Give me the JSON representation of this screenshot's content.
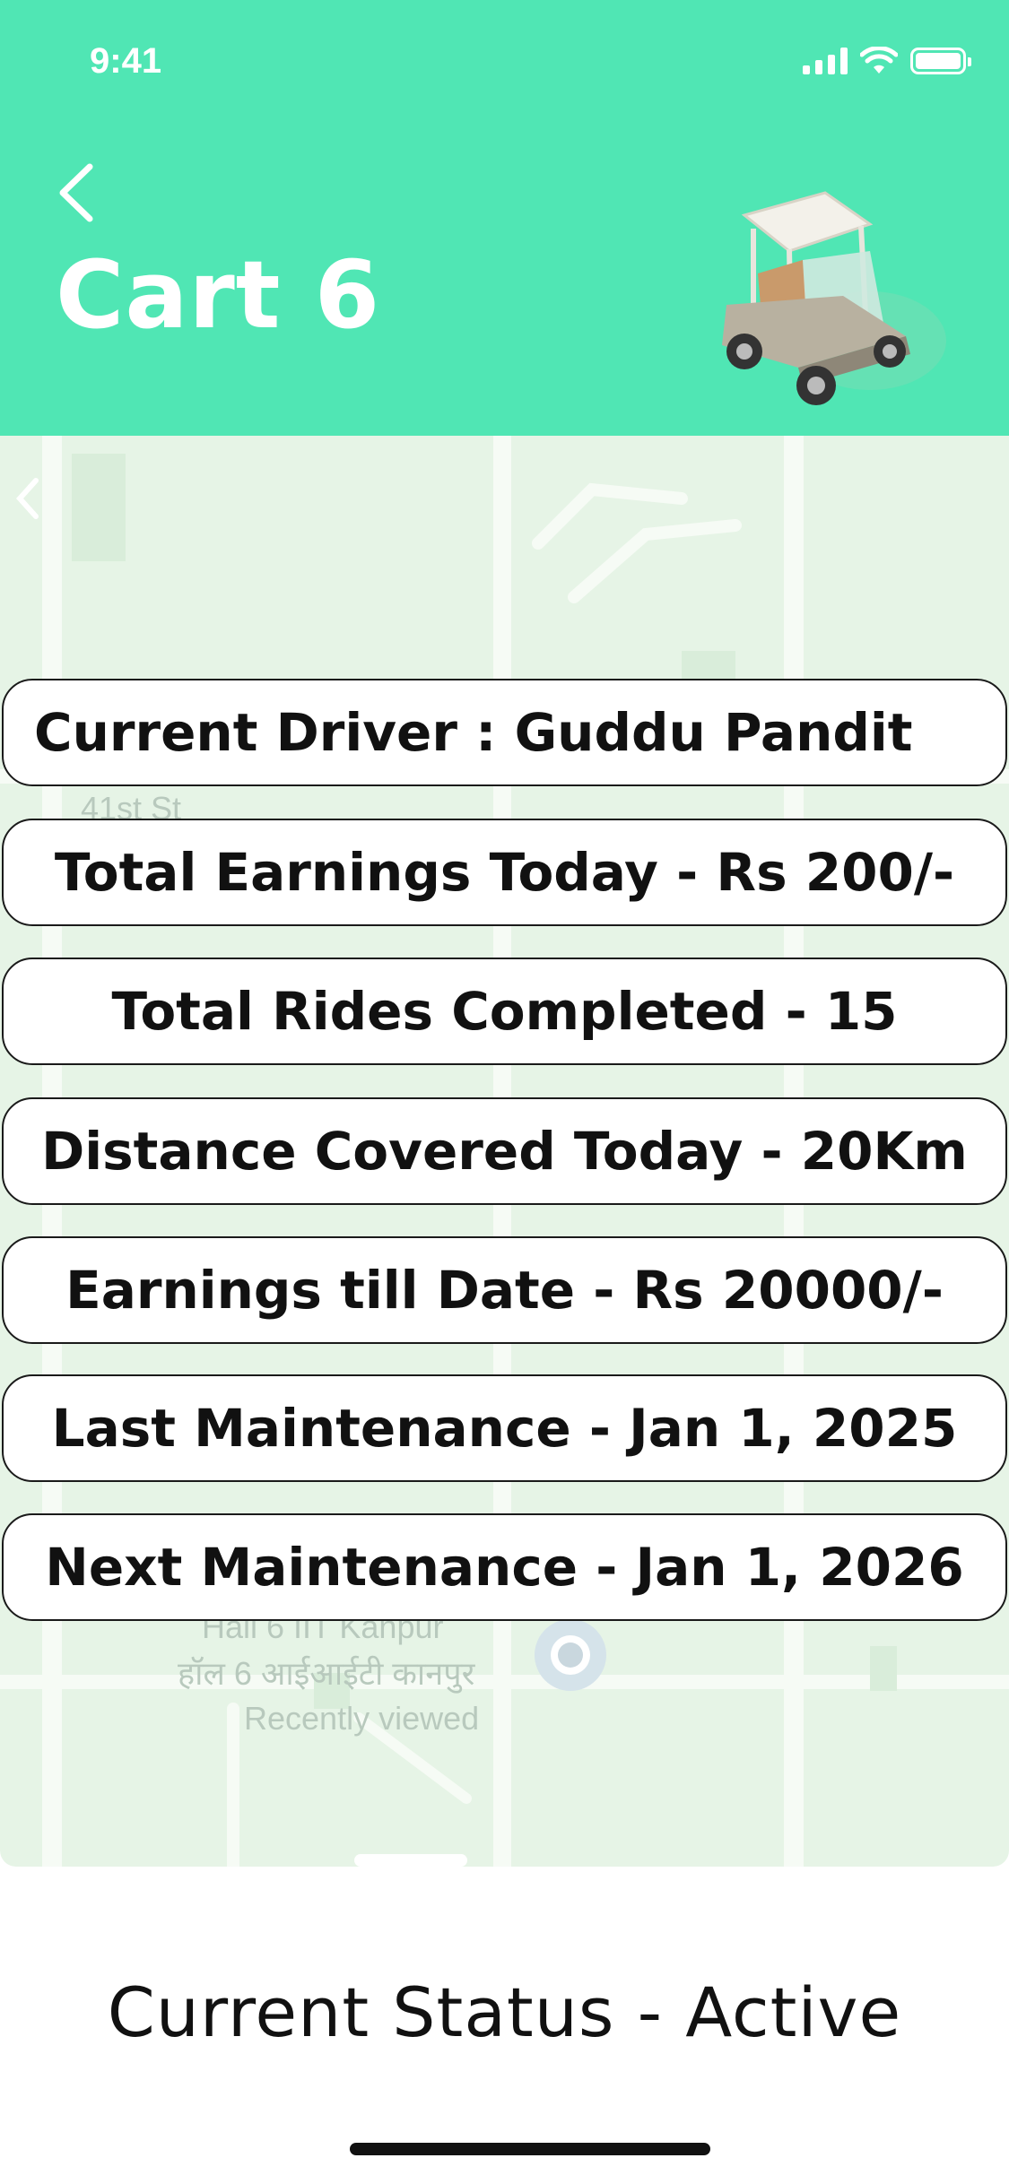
{
  "status_bar": {
    "time": "9:41"
  },
  "header": {
    "title": "Cart 6"
  },
  "map": {
    "street_label": "41st St",
    "place_label_en": "Hall 6 IIT Kanpur",
    "place_label_hi": "हॉल 6 आईआईटी कानपुर",
    "place_sublabel": "Recently viewed"
  },
  "details": [
    {
      "text": "Current Driver : Guddu Pandit"
    },
    {
      "text": "Total Earnings Today - Rs 200/-"
    },
    {
      "text": "Total Rides Completed - 15"
    },
    {
      "text": "Distance Covered Today - 20Km"
    },
    {
      "text": "Earnings till Date - Rs 20000/-"
    },
    {
      "text": "Last Maintenance - Jan 1, 2025"
    },
    {
      "text": "Next Maintenance - Jan 1, 2026"
    }
  ],
  "footer": {
    "status_text": "Current Status - Active"
  },
  "colors": {
    "header_bg": "#50e6b4",
    "map_bg": "#e6f4e6",
    "text": "#111111"
  }
}
